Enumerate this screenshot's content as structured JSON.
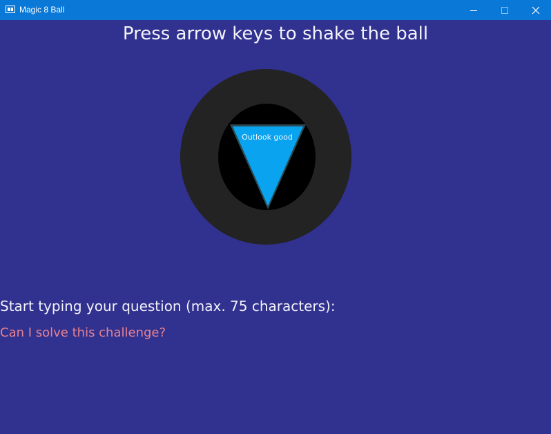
{
  "window": {
    "title": "Magic 8 Ball",
    "icon": "app-window-icon",
    "controls": {
      "minimize": "minimize-icon",
      "maximize": "maximize-icon",
      "close": "close-icon"
    }
  },
  "main": {
    "heading": "Press arrow keys to shake the ball",
    "answer": "Outlook good",
    "prompt": "Start typing your question (max. 75 characters):",
    "question_value": "Can I solve this challenge?"
  },
  "colors": {
    "background": "#31318f",
    "titlebar": "#0a78d7",
    "ball": "#232323",
    "ball_window": "#000000",
    "die": "#0aa3ef",
    "question_text": "#e8828f"
  }
}
